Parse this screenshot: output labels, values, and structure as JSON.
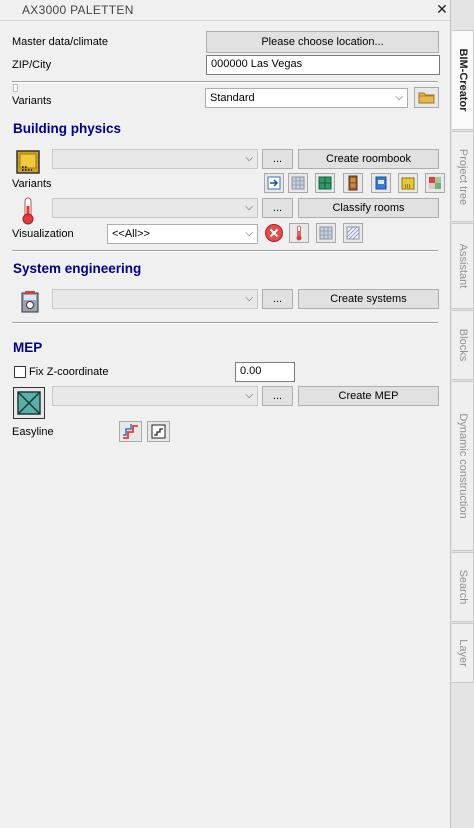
{
  "window": {
    "title": "AX3000 PALETTEN",
    "close_glyph": "✕"
  },
  "master": {
    "label": "Master data/climate",
    "location_button": "Please choose location...",
    "zip_label": "ZIP/City",
    "zip_value": "000000 Las Vegas",
    "variants_label": "Variants",
    "variants_value": "Standard"
  },
  "building_physics": {
    "title": "Building physics",
    "more_label": "...",
    "create_button": "Create roombook",
    "variants_label": "Variants",
    "classify_more": "...",
    "classify_button": "Classify rooms",
    "visualization_label": "Visualization",
    "visualization_value": "<<All>>"
  },
  "system_engineering": {
    "title": "System engineering",
    "more_label": "...",
    "create_button": "Create systems"
  },
  "mep": {
    "title": "MEP",
    "fix_z_label": "Fix Z-coordinate",
    "z_value": "0.00",
    "more_label": "...",
    "create_button": "Create MEP",
    "easyline_label": "Easyline"
  },
  "tabs": [
    {
      "label": "BIM-Creator"
    },
    {
      "label": "Project tree"
    },
    {
      "label": "Assistant"
    },
    {
      "label": "Blocks"
    },
    {
      "label": "Dynamic construction"
    },
    {
      "label": "Search"
    },
    {
      "label": "Layer"
    }
  ],
  "colors": {
    "accent_heading": "#00008b",
    "panel_bg": "#f0f0f0"
  }
}
